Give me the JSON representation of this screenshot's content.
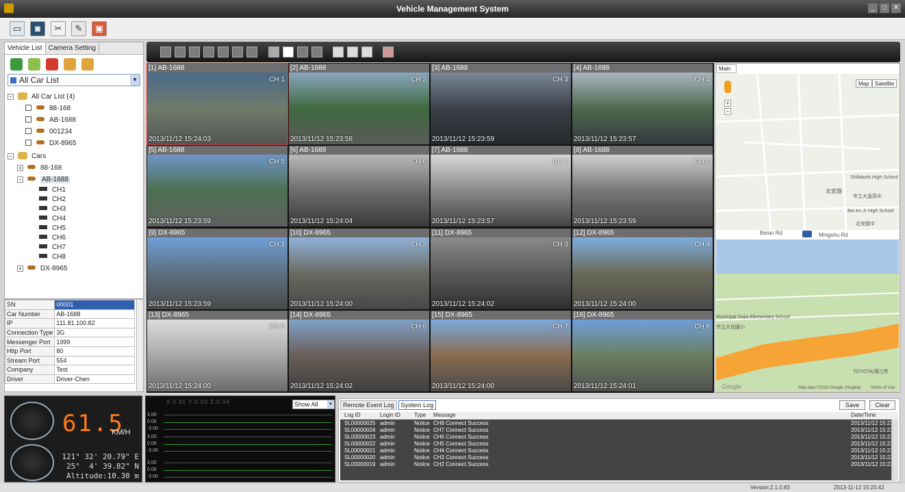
{
  "app": {
    "title": "Vehicle Management System"
  },
  "window_buttons": [
    "_",
    "□",
    "✕"
  ],
  "toolbar": {
    "icons": [
      "monitor-icon",
      "camera-icon",
      "tools-icon",
      "broom-icon",
      "playback-icon"
    ]
  },
  "left_tabs": [
    {
      "label": "Vehicle List",
      "active": true
    },
    {
      "label": "Camera Setting",
      "active": false
    }
  ],
  "carlist_select": "All Car List",
  "tree": {
    "all_car_list": "All Car List (4)",
    "all_cars": [
      "88-168",
      "AB-1688",
      "001234",
      "DX-8965"
    ],
    "cars_root": "Cars",
    "cars": [
      "88-168",
      "AB-1688",
      "DX-8965"
    ],
    "channels": [
      "CH1",
      "CH2",
      "CH3",
      "CH4",
      "CH5",
      "CH6",
      "CH7",
      "CH8"
    ]
  },
  "properties": [
    {
      "key": "SN",
      "value": "00001"
    },
    {
      "key": "Car Number",
      "value": "AB-1688"
    },
    {
      "key": "IP",
      "value": "111.81.100.82"
    },
    {
      "key": "Connection Type",
      "value": "3G"
    },
    {
      "key": "Messenger Port",
      "value": "1999"
    },
    {
      "key": "Http Port",
      "value": "80"
    },
    {
      "key": "Stream Port",
      "value": "554"
    },
    {
      "key": "Company",
      "value": "Test"
    },
    {
      "key": "Driver",
      "value": "Driver-Chen"
    }
  ],
  "videos": [
    {
      "header": "[1] AB-1688",
      "ch": "CH 1",
      "ts": "2013/11/12 15:24:03",
      "colors": [
        "#4a6b8a",
        "#6e7b6a",
        "#545454"
      ]
    },
    {
      "header": "[2] AB-1688",
      "ch": "CH 2",
      "ts": "2013/11/12 15:23:58",
      "colors": [
        "#8aa6bf",
        "#3f6a3f",
        "#5a5a5a"
      ]
    },
    {
      "header": "[3] AB-1688",
      "ch": "CH 3",
      "ts": "2013/11/12 15:23:59",
      "colors": [
        "#7a8898",
        "#3a4048",
        "#26292c"
      ]
    },
    {
      "header": "[4] AB-1688",
      "ch": "CH 4",
      "ts": "2013/11/12 15:23:57",
      "colors": [
        "#a9b5bf",
        "#4f6a4f",
        "#33383d"
      ]
    },
    {
      "header": "[5] AB-1688",
      "ch": "CH 5",
      "ts": "2013/11/12 15:23:59",
      "colors": [
        "#6d95c7",
        "#4d7050",
        "#5f5f5f"
      ]
    },
    {
      "header": "[6] AB-1688",
      "ch": "CH 6",
      "ts": "2013/11/12 15:24:04",
      "colors": [
        "#b9b9b9",
        "#6d6d6d",
        "#3a3a3a"
      ]
    },
    {
      "header": "[7] AB-1688",
      "ch": "CH 7",
      "ts": "2013/11/12 15:23:57",
      "colors": [
        "#d7d7d7",
        "#8a8a8a",
        "#444444"
      ]
    },
    {
      "header": "[8] AB-1688",
      "ch": "CH 8",
      "ts": "2013/11/12 15:23:59",
      "colors": [
        "#cfcfcf",
        "#777777",
        "#4a4a4a"
      ]
    },
    {
      "header": "[9] DX-8965",
      "ch": "CH 1",
      "ts": "2013/11/12 15:23:59",
      "colors": [
        "#6f9fd8",
        "#5c6f80",
        "#4a4a4a"
      ]
    },
    {
      "header": "[10] DX-8965",
      "ch": "CH 2",
      "ts": "2013/11/12 15:24:00",
      "colors": [
        "#8fb2d9",
        "#6a6a62",
        "#474747"
      ]
    },
    {
      "header": "[11] DX-8965",
      "ch": "CH 3",
      "ts": "2013/11/12 15:24:02",
      "colors": [
        "#8a8a8a",
        "#5a5a5a",
        "#2e2e2e"
      ]
    },
    {
      "header": "[12] DX-8965",
      "ch": "CH 4",
      "ts": "2013/11/12 15:24:00",
      "colors": [
        "#7eaee0",
        "#6a6a58",
        "#4a4a4a"
      ]
    },
    {
      "header": "[13] DX-8965",
      "ch": "CH 5",
      "ts": "2013/11/12 15:24:00",
      "colors": [
        "#dcdcdc",
        "#a9a9a9",
        "#6b6b6b"
      ]
    },
    {
      "header": "[14] DX-8965",
      "ch": "CH 6",
      "ts": "2013/11/12 15:24:02",
      "colors": [
        "#7fa3c9",
        "#6a5e58",
        "#404040"
      ]
    },
    {
      "header": "[15] DX-8965",
      "ch": "CH 7",
      "ts": "2013/11/12 15:24:00",
      "colors": [
        "#7aa8dc",
        "#8a6c4e",
        "#4a4a4a"
      ]
    },
    {
      "header": "[16] DX-8965",
      "ch": "CH 8",
      "ts": "2013/11/12 15:24:01",
      "colors": [
        "#6e9fd8",
        "#6b7f60",
        "#505050"
      ]
    }
  ],
  "map": {
    "tab": "Main",
    "map_btn": "Map",
    "satellite_btn": "Satellite",
    "labels": [
      "北安路",
      "Beian Rd",
      "Mingshu Rd",
      "Shilidazhi High School",
      "市立大直高中",
      "Bei An Jr High School",
      "北安國中",
      "Municipal Dajia Elementary School",
      "市立大佳國小",
      "TOYOTA(濱江所",
      "Google",
      "Map data ©2013 Google, Kingway",
      "Terms of Use"
    ]
  },
  "speed": {
    "value": "61.5",
    "unit": "KM/H"
  },
  "gps": {
    "lon": "121° 32' 20.79\" E",
    "lat": "25°  4' 39.82\" N",
    "altitude": "Altitude:10.30 m"
  },
  "gsensor": {
    "readout": "X:0.01  Y:0.00  Z:0.04",
    "y_labels": [
      "3.00",
      "0.00",
      "-3.00",
      "3.00",
      "0.00",
      "-3.00",
      "3.00",
      "0.00",
      "-3.00"
    ]
  },
  "filter": "Show All",
  "log": {
    "tabs": [
      {
        "label": "Remote Event Log",
        "active": false
      },
      {
        "label": "System Log",
        "active": true
      }
    ],
    "save": "Save",
    "clear": "Clear",
    "columns": [
      "Log ID",
      "Login ID",
      "Type",
      "Message",
      "Date/Time"
    ],
    "rows": [
      [
        "SL00000025",
        "admin",
        "Notice",
        "CH8 Connect Success",
        "2013/11/12 15:23"
      ],
      [
        "SL00000024",
        "admin",
        "Notice",
        "CH7 Connect Success",
        "2013/11/12 15:23"
      ],
      [
        "SL00000023",
        "admin",
        "Notice",
        "CH6 Connect Success",
        "2013/11/12 15:23"
      ],
      [
        "SL00000022",
        "admin",
        "Notice",
        "CH5 Connect Success",
        "2013/11/12 15:23"
      ],
      [
        "SL00000021",
        "admin",
        "Notice",
        "CH4 Connect Success",
        "2013/11/12 15:23"
      ],
      [
        "SL00000020",
        "admin",
        "Notice",
        "CH3 Connect Success",
        "2013/11/12 15:23"
      ],
      [
        "SL00000019",
        "admin",
        "Notice",
        "CH2 Connect Success",
        "2013/11/12 15:23"
      ]
    ]
  },
  "status": {
    "version": "Version:2.1.0.83",
    "datetime": "2013-11-12 15:25:42"
  }
}
